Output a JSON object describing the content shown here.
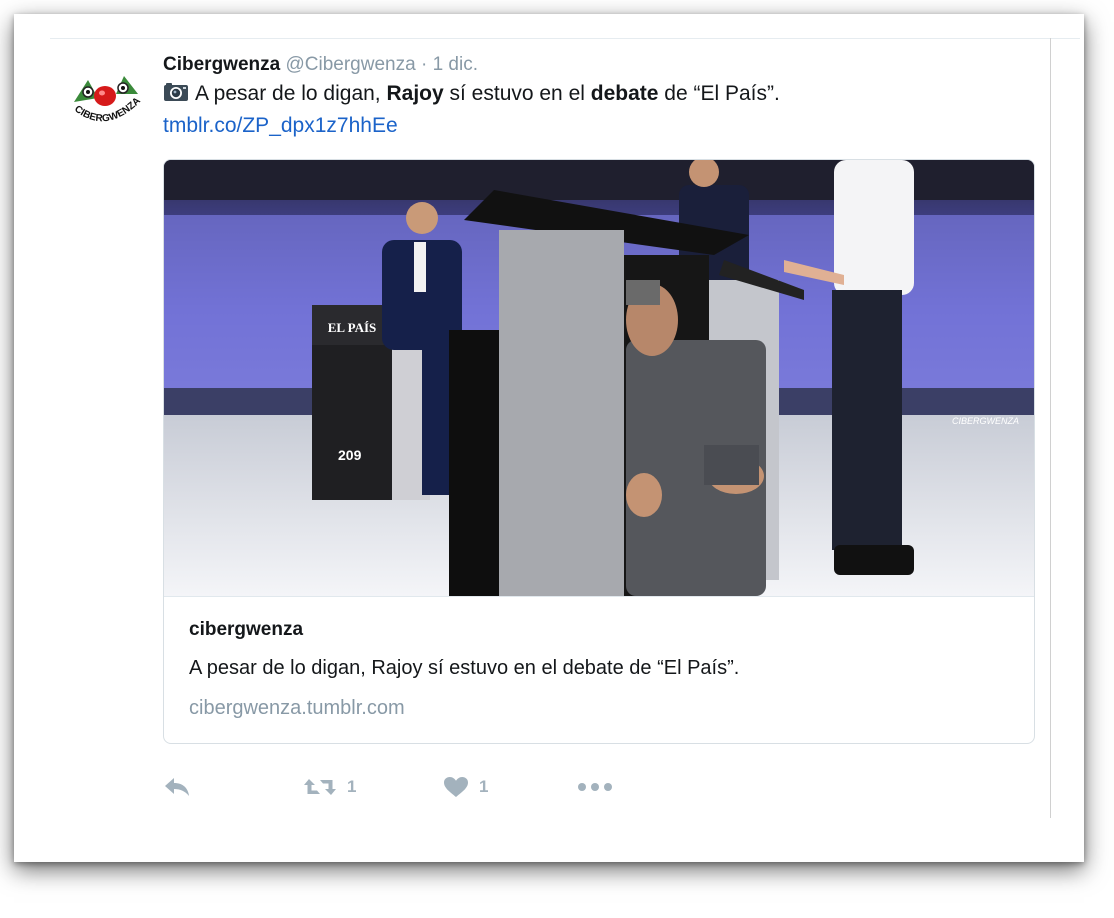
{
  "tweet": {
    "display_name": "Cibergwenza",
    "handle": "@Cibergwenza",
    "separator": "·",
    "timestamp": "1 dic.",
    "avatar_text": "CIBERGWENZA",
    "text_parts": [
      "A pesar de lo digan, ",
      "Rajoy",
      " sí estuvo en el ",
      "debate",
      " de “El País”."
    ],
    "link": "tmblr.co/ZP_dpx1z7hhEe"
  },
  "card": {
    "image_labels": {
      "podium_logo": "EL PAÍS",
      "podium_number": "209",
      "watermark": "CIBERGWENZA"
    },
    "title": "cibergwenza",
    "description": "A pesar de lo digan, Rajoy sí estuvo en el debate de “El País”.",
    "domain": "cibergwenza.tumblr.com"
  },
  "actions": {
    "retweet_count": "1",
    "like_count": "1",
    "icons": [
      "reply-icon",
      "retweet-icon",
      "heart-icon",
      "more-icon"
    ]
  },
  "colors": {
    "link": "#1b63c9",
    "muted": "#8899a6",
    "action": "#a3b2bd",
    "text": "#14171a"
  }
}
